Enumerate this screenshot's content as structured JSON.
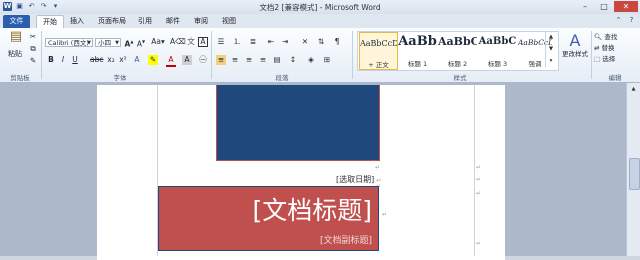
{
  "window": {
    "title": "文档2 [兼容模式] - Microsoft Word",
    "qat_icons": [
      "word-icon",
      "save-icon",
      "undo-icon",
      "redo-icon",
      "customize-qat-icon"
    ]
  },
  "tabs": [
    "文件",
    "开始",
    "插入",
    "页面布局",
    "引用",
    "邮件",
    "审阅",
    "视图"
  ],
  "ribbon": {
    "clipboard": {
      "paste": "粘贴",
      "label": "剪贴板"
    },
    "font": {
      "name": "Calibri (西文)",
      "size": "小四",
      "label": "字体"
    },
    "paragraph": {
      "label": "段落"
    },
    "styles": {
      "label": "样式",
      "items": [
        {
          "preview": "AaBbCcD",
          "label": "+ 正文"
        },
        {
          "preview": "AaBb",
          "label": "标题 1"
        },
        {
          "preview": "AaBbC",
          "label": "标题 2"
        },
        {
          "preview": "AaBbC",
          "label": "标题 3"
        },
        {
          "preview": "AaBbCcD",
          "label": "强调"
        }
      ],
      "change_styles": "更改样式"
    },
    "editing": {
      "find": "查找",
      "replace": "替换",
      "select": "选择",
      "label": "编辑"
    }
  },
  "document": {
    "date_placeholder": "[选取日期]",
    "title": "[文档标题]",
    "subtitle": "[文档副标题]",
    "paragraph_mark": "↵"
  },
  "colors": {
    "blue_block": "#1f497d",
    "red_block": "#c0504d",
    "file_tab": "#2b5fae"
  }
}
